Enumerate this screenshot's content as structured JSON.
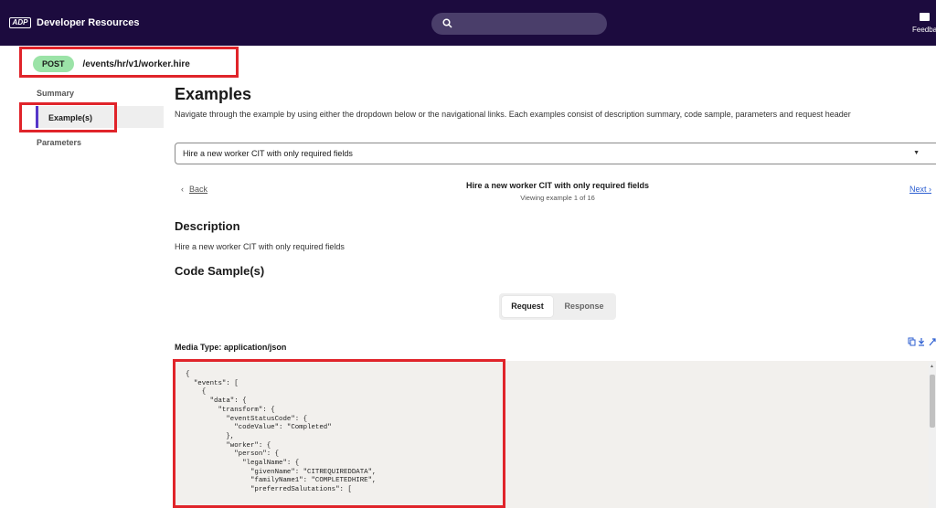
{
  "header": {
    "logo_text": "ADP",
    "brand": "Developer Resources",
    "feedback_label": "Feedba"
  },
  "endpoint": {
    "method": "POST",
    "path": "/events/hr/v1/worker.hire"
  },
  "sidebar": {
    "items": [
      {
        "label": "Summary"
      },
      {
        "label": "Example(s)"
      },
      {
        "label": "Parameters"
      }
    ]
  },
  "examples": {
    "title": "Examples",
    "intro": "Navigate through the example by using either the dropdown below or the navigational links. Each examples consist of description summary, code sample, parameters and request header",
    "selected": "Hire a new worker CIT with only required fields",
    "back_arrow": "‹",
    "back": "Back",
    "next": "Next ›",
    "nav_title": "Hire a new worker CIT with only required fields",
    "nav_sub": "Viewing example 1 of 16"
  },
  "description": {
    "heading": "Description",
    "text": "Hire a new worker CIT with only required fields"
  },
  "code": {
    "heading": "Code Sample(s)",
    "tabs": [
      "Request",
      "Response"
    ],
    "active_tab": "Request",
    "media_type": "Media Type: application/json",
    "lines": [
      "{",
      "  \"events\": [",
      "    {",
      "      \"data\": {",
      "        \"transform\": {",
      "          \"eventStatusCode\": {",
      "            \"codeValue\": \"Completed\"",
      "          },",
      "          \"worker\": {",
      "            \"person\": {",
      "              \"legalName\": {",
      "                \"givenName\": \"CITREQUIREDDATA\",",
      "                \"familyName1\": \"COMPLETEDHIRE\",",
      "                \"preferredSalutations\": ["
    ]
  },
  "colors": {
    "header_bg": "#1c0b3e",
    "highlight": "#e0242a",
    "post_badge": "#9be3a7",
    "accent": "#5536c8",
    "link": "#2d5fd1"
  }
}
